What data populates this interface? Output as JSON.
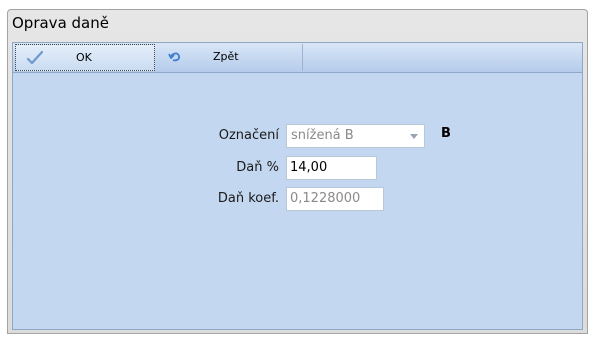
{
  "window": {
    "title": "Oprava daně"
  },
  "toolbar": {
    "ok_label": "OK",
    "back_label": "Zpět"
  },
  "form": {
    "designation_label": "Označení",
    "designation_value": "snížená B",
    "designation_code": "B",
    "tax_percent_label": "Daň %",
    "tax_percent_value": "14,00",
    "tax_coef_label": "Daň koef.",
    "tax_coef_value": "0,1228000"
  },
  "icons": {
    "ok": "checkmark-icon",
    "back": "undo-icon",
    "dropdown": "chevron-down-icon"
  },
  "colors": {
    "client_bg": "#c4d7f0",
    "toolbar_bg": "#c6d9f1"
  }
}
